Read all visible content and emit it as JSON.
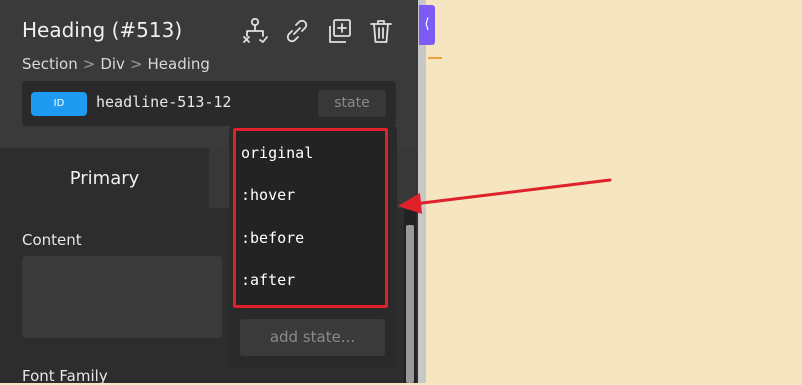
{
  "header": {
    "title": "Heading (#513)",
    "icons": [
      "structure-icon",
      "link-icon",
      "duplicate-icon",
      "trash-icon"
    ]
  },
  "breadcrumb": [
    "Section",
    "Div",
    "Heading"
  ],
  "breadcrumb_separator": ">",
  "selector": {
    "badge": "ID",
    "id_value": "headline-513-12",
    "state_label": "state"
  },
  "tabs": {
    "primary": "Primary"
  },
  "fields": {
    "content_label": "Content",
    "font_family_label": "Font Family"
  },
  "state_dropdown": {
    "options": [
      "original",
      ":hover",
      ":before",
      ":after"
    ],
    "add_state": "add state..."
  },
  "collapse_glyph": "⟨",
  "colors": {
    "panel_bg": "#3a3a3a",
    "canvas_bg": "#f5e5c0",
    "id_badge": "#1e9bf0",
    "highlight": "#e0202a",
    "collapse_tab": "#7c5cf5"
  }
}
